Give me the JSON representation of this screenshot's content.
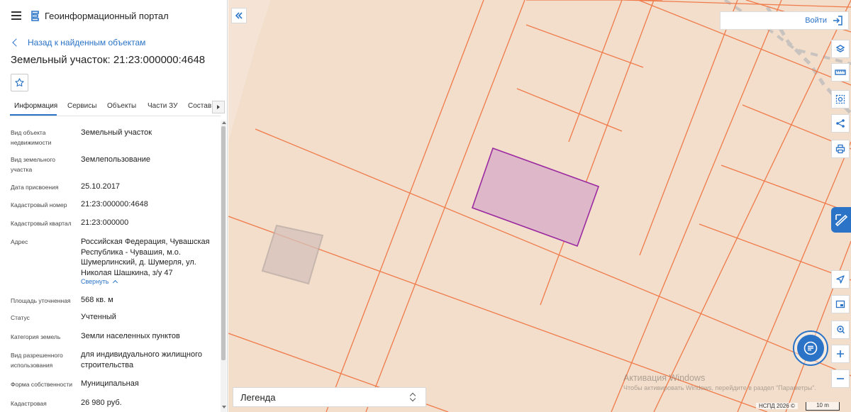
{
  "header": {
    "portal_title": "Геоинформационный портал",
    "back_link": "Назад к найденным объектам",
    "object_title": "Земельный участок: 21:23:000000:4648"
  },
  "tabs": [
    {
      "label": "Информация",
      "active": true
    },
    {
      "label": "Сервисы",
      "active": false
    },
    {
      "label": "Объекты",
      "active": false
    },
    {
      "label": "Части ЗУ",
      "active": false
    },
    {
      "label": "Состав",
      "active": false
    }
  ],
  "attributes": [
    {
      "label": "Вид объекта недвижимости",
      "value": "Земельный участок"
    },
    {
      "label": "Вид земельного участка",
      "value": "Землепользование"
    },
    {
      "label": "Дата присвоения",
      "value": "25.10.2017"
    },
    {
      "label": "Кадастровый номер",
      "value": "21:23:000000:4648"
    },
    {
      "label": "Кадастровый квартал",
      "value": "21:23:000000"
    },
    {
      "label": "Адрес",
      "value": "Российская Федерация, Чувашская Республика - Чувашия, м.о. Шумерлинский, д. Шумерля, ул. Николая Шашкина, з/у 47"
    },
    {
      "label": "Площадь уточненная",
      "value": "568 кв. м"
    },
    {
      "label": "Статус",
      "value": "Учтенный"
    },
    {
      "label": "Категория земель",
      "value": "Земли населенных пунктов"
    },
    {
      "label": "Вид разрешенного использования",
      "value": "для индивидуального жилищного строительства"
    },
    {
      "label": "Форма собственности",
      "value": "Муниципальная"
    },
    {
      "label": "Кадастровая",
      "value": "26 980 руб."
    }
  ],
  "address_collapse": "Свернуть",
  "map": {
    "login_label": "Войти",
    "legend_label": "Легенда",
    "watermark_title": "Активация Windows",
    "watermark_sub": "Чтобы активировать Windows, перейдите в раздел \"Параметры\".",
    "copyright": "НСПД 2026 ©",
    "scale_label": "10 m",
    "colors": {
      "background": "#f2decb",
      "parcel_border": "#f07a4a",
      "selected_fill": "#deb8c8",
      "selected_border": "#9b2aa0",
      "accent": "#2a73c7"
    },
    "tools": [
      "layers-icon",
      "ruler-icon",
      "select-area-icon",
      "share-icon",
      "print-icon",
      "navigate-icon",
      "picture-in-picture-icon",
      "location-search-icon",
      "zoom-in-icon",
      "zoom-out-icon"
    ]
  }
}
